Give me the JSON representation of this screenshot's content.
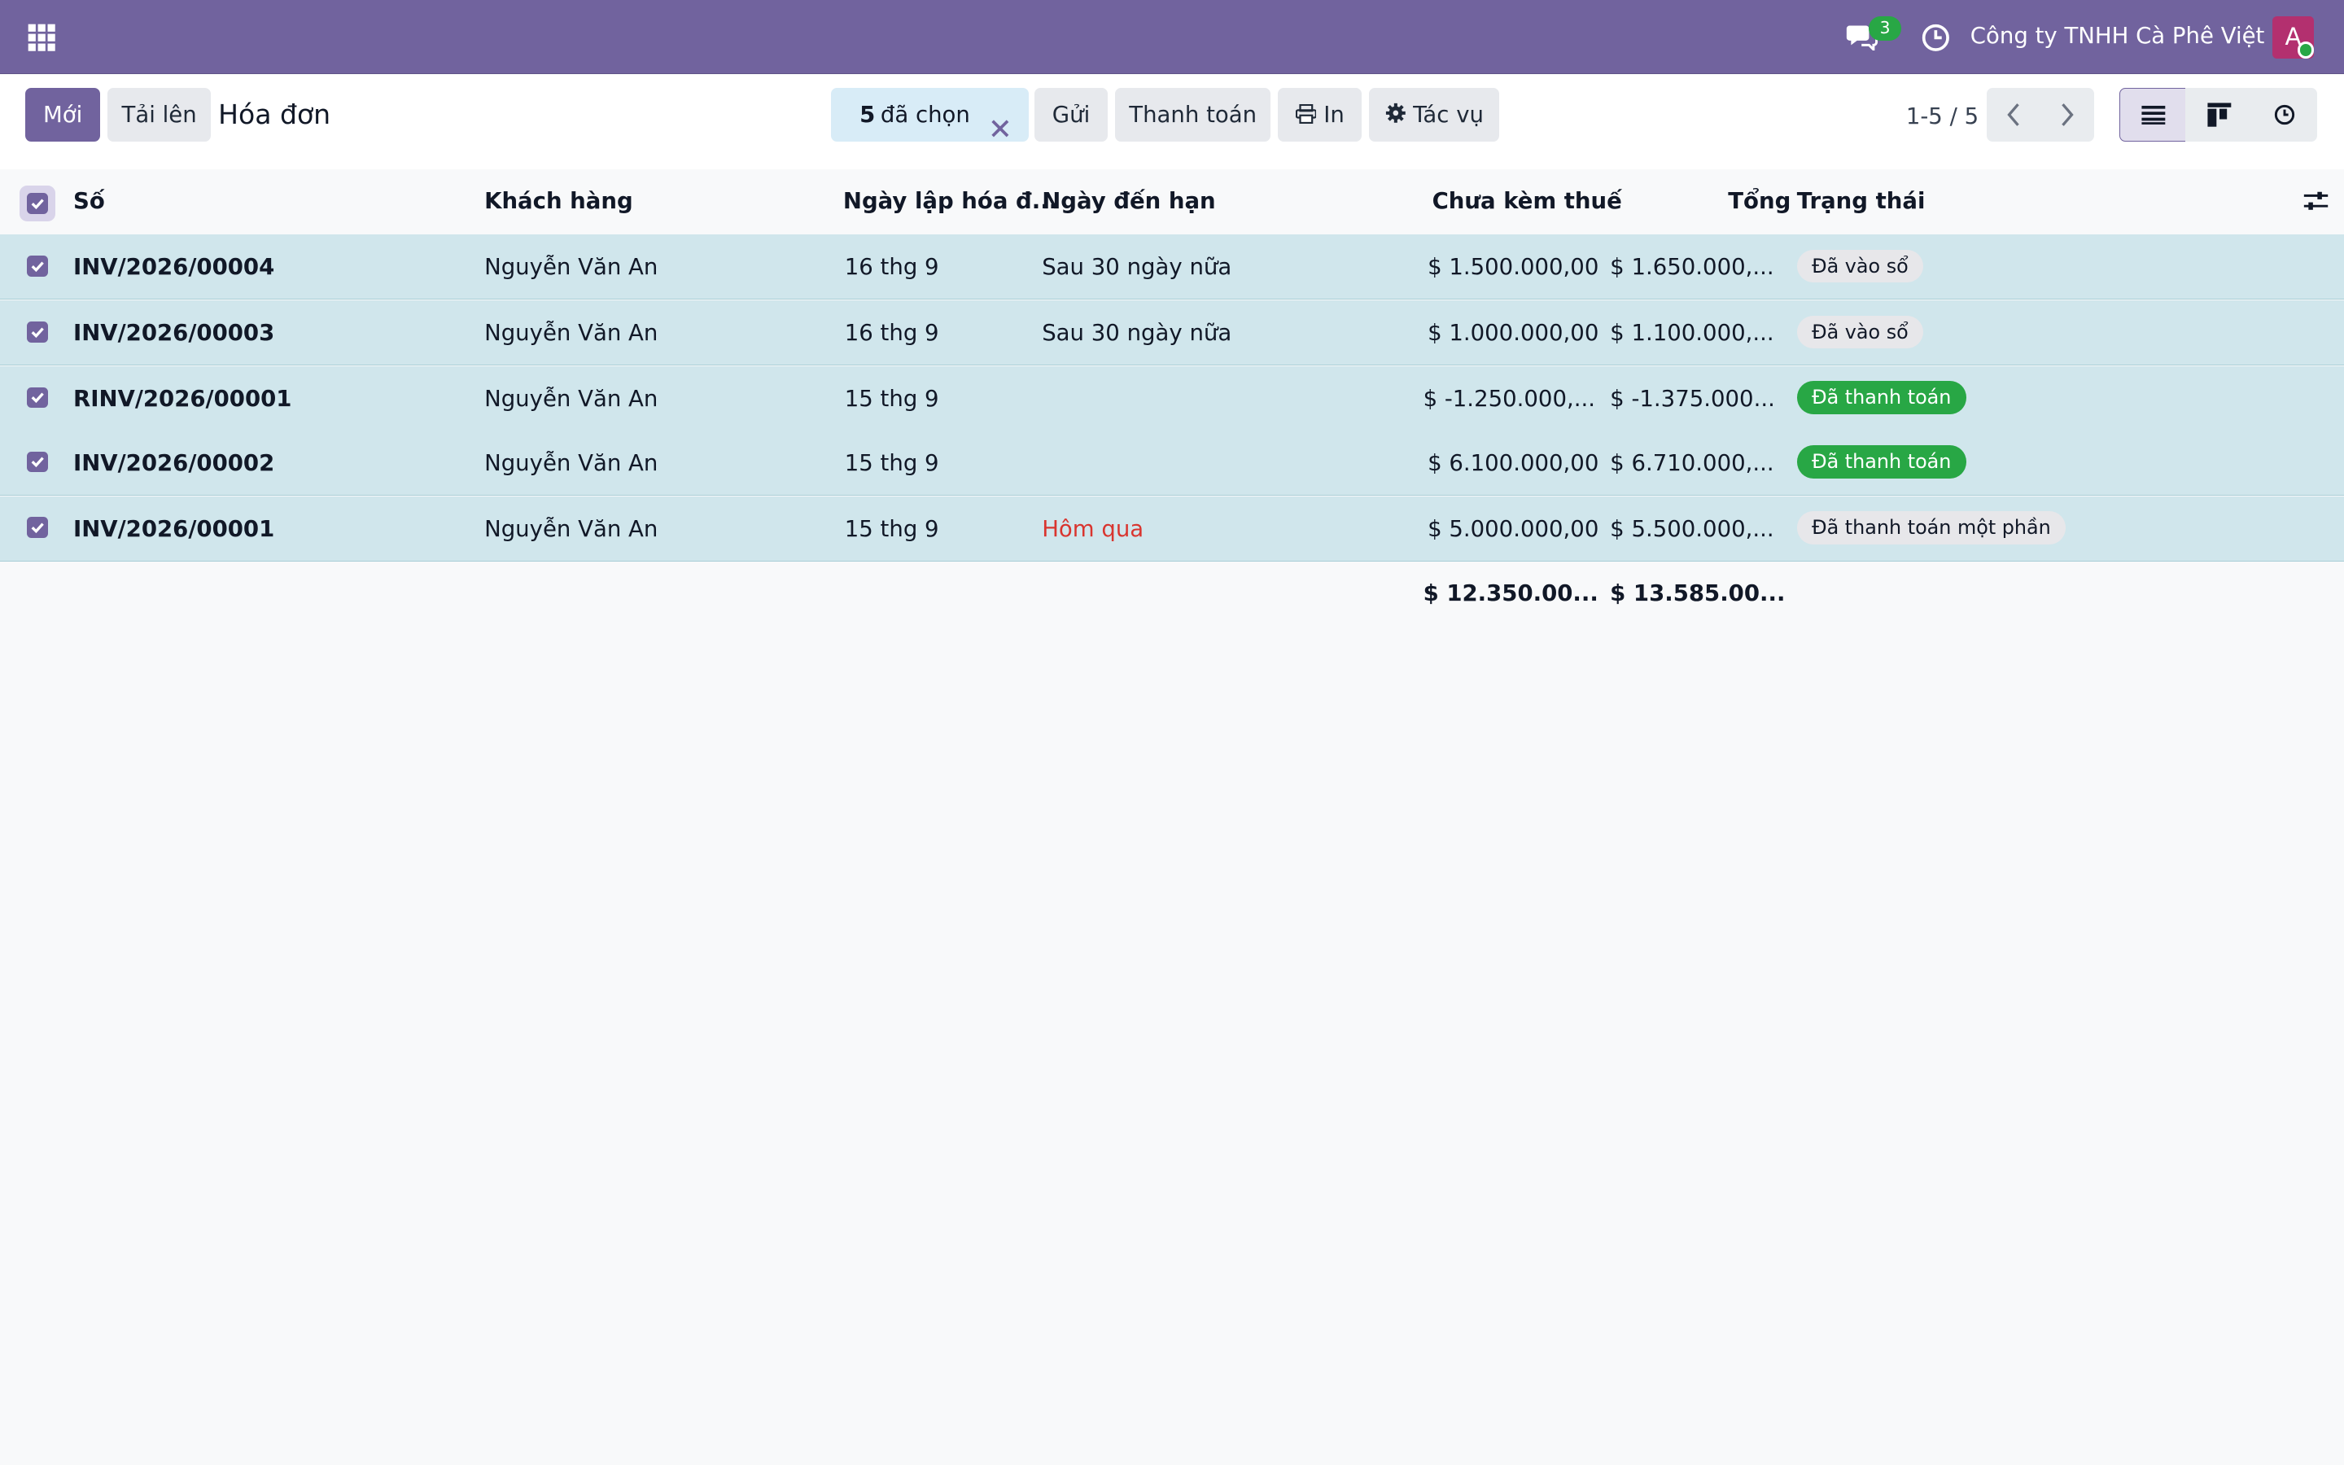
{
  "topbar": {
    "chat_count": "3",
    "company": "Công ty TNHH Cà Phê Việt",
    "avatar_letter": "A",
    "colors": {
      "bar": "#71639e",
      "badge": "#28a745",
      "avatar": "#b3306f"
    }
  },
  "control": {
    "new_label": "Mới",
    "upload_label": "Tải lên",
    "title": "Hóa đơn",
    "selected_count": "5",
    "selected_label": "đã chọn",
    "send_label": "Gửi",
    "payment_label": "Thanh toán",
    "print_label": "In",
    "actions_label": "Tác vụ",
    "pager": "1-5 / 5"
  },
  "table": {
    "columns": {
      "number": "Số",
      "customer": "Khách hàng",
      "invoice_date": "Ngày lập hóa đ...",
      "due_date": "Ngày đến hạn",
      "untaxed": "Chưa kèm thuế",
      "total": "Tổng",
      "status": "Trạng thái"
    },
    "rows": [
      {
        "number": "INV/2026/00004",
        "customer": "Nguyễn Văn An",
        "invoice_date": "16 thg 9",
        "due_date": "Sau 30 ngày nữa",
        "untaxed": "$ 1.500.000,00",
        "total": "$ 1.650.000,...",
        "status": "Đã vào sổ"
      },
      {
        "number": "INV/2026/00003",
        "customer": "Nguyễn Văn An",
        "invoice_date": "16 thg 9",
        "due_date": "Sau 30 ngày nữa",
        "untaxed": "$ 1.000.000,00",
        "total": "$ 1.100.000,...",
        "status": "Đã vào sổ"
      },
      {
        "number": "RINV/2026/00001",
        "customer": "Nguyễn Văn An",
        "invoice_date": "15 thg 9",
        "due_date": "",
        "untaxed": "$ -1.250.000,...",
        "total": "$ -1.375.000...",
        "status": "Đã thanh toán"
      },
      {
        "number": "INV/2026/00002",
        "customer": "Nguyễn Văn An",
        "invoice_date": "15 thg 9",
        "due_date": "",
        "untaxed": "$ 6.100.000,00",
        "total": "$ 6.710.000,...",
        "status": "Đã thanh toán"
      },
      {
        "number": "INV/2026/00001",
        "customer": "Nguyễn Văn An",
        "invoice_date": "15 thg 9",
        "due_date": "Hôm qua",
        "untaxed": "$ 5.000.000,00",
        "total": "$ 5.500.000,...",
        "status": "Đã thanh toán một phần"
      }
    ],
    "totals": {
      "untaxed": "$ 12.350.00...",
      "total": "$ 13.585.00..."
    },
    "status_colors": {
      "posted": "#e7e7ea",
      "paid": "#28a745",
      "row_selected": "#d0e6ec",
      "overdue": "#d9352f"
    }
  }
}
